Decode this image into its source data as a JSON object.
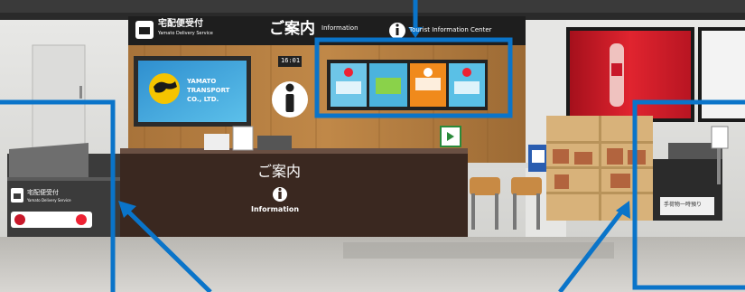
{
  "colors": {
    "annotation_blue": "#0a74c9",
    "sign_black": "#1e1e1e",
    "wood": "#9c6a34",
    "counter_brown": "#3a2820",
    "yamato_blue": "#3aa0d8",
    "coke_red": "#c8182a"
  },
  "signage": {
    "top_left_sign": "宅配便受付",
    "top_left_sign_sub": "Yamato Delivery Service",
    "main_sign_jp": "ご案内",
    "main_sign_en": "Information",
    "main_sign_right": "Tourist Information Center",
    "clock": "16:01"
  },
  "yamato_screen": {
    "line1": "YAMATO",
    "line2": "TRANSPORT",
    "line3": "CO., LTD."
  },
  "counter": {
    "label_jp": "ご案内",
    "info_icon": "info-icon",
    "label_en": "Information"
  },
  "side_panel": {
    "label": "宅配便受付",
    "sub": "Yamato Delivery Service"
  },
  "right_sign": {
    "label": "手荷物一時預り"
  }
}
